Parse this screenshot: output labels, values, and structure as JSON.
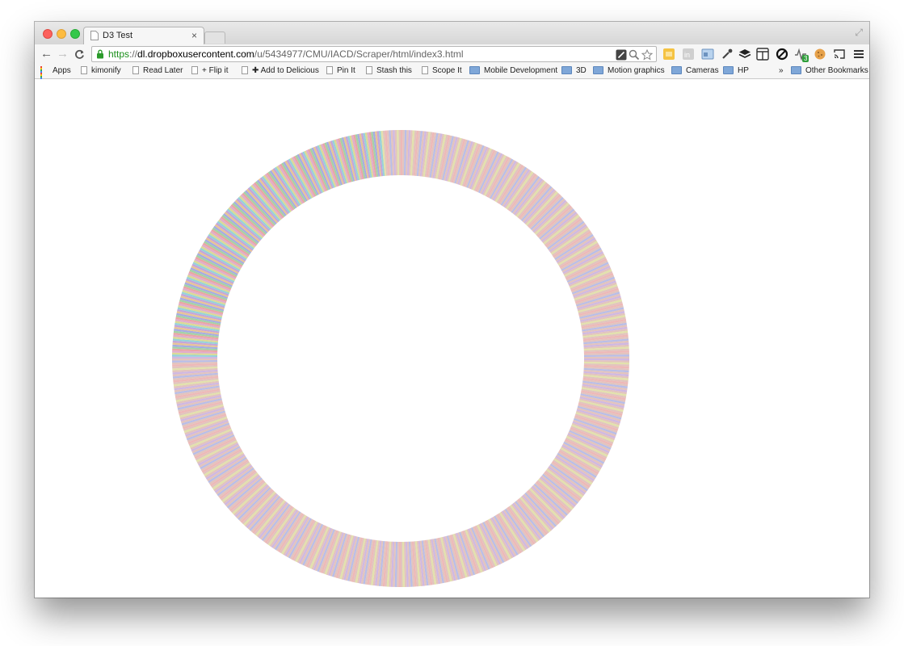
{
  "window": {
    "tab_title": "D3 Test",
    "tab_close": "×",
    "icons": [
      "close-icon",
      "minimize-icon",
      "maximize-icon",
      "fullscreen-icon"
    ]
  },
  "toolbar": {
    "back": "←",
    "forward": "→",
    "reload": "C",
    "url_scheme": "https",
    "url_separator": "://",
    "url_host": "dl.dropboxusercontent.com",
    "url_path": "/u/5434977/CMU/IACD/Scraper/html/index3.html",
    "extension_badge": "3"
  },
  "bookmarks": [
    {
      "label": "Apps",
      "icon": "apps-grid-icon"
    },
    {
      "label": "kimonify",
      "icon": "page-icon"
    },
    {
      "label": "Read Later",
      "icon": "page-icon"
    },
    {
      "label": "+ Flip it",
      "icon": "page-icon"
    },
    {
      "label": "✚ Add to Delicious",
      "icon": "page-icon"
    },
    {
      "label": "Pin It",
      "icon": "page-icon"
    },
    {
      "label": "Stash this",
      "icon": "page-icon"
    },
    {
      "label": "Scope It",
      "icon": "page-icon"
    },
    {
      "label": "Mobile Development",
      "icon": "folder-icon"
    },
    {
      "label": "3D",
      "icon": "folder-icon"
    },
    {
      "label": "Motion graphics",
      "icon": "folder-icon"
    },
    {
      "label": "Cameras",
      "icon": "folder-icon"
    },
    {
      "label": "HP",
      "icon": "folder-icon"
    }
  ],
  "bookmarks_overflow": "»",
  "other_bookmarks": "Other Bookmarks",
  "colors": {
    "ring_palette": [
      "#e8a0a0",
      "#9fd0a0",
      "#a0a8e0",
      "#e8c090",
      "#c0a0d8",
      "#90d0d8",
      "#d8d890",
      "#e0a8c8"
    ],
    "ring_muted": "#d8b0a8",
    "url_green": "#1a8f1a"
  }
}
